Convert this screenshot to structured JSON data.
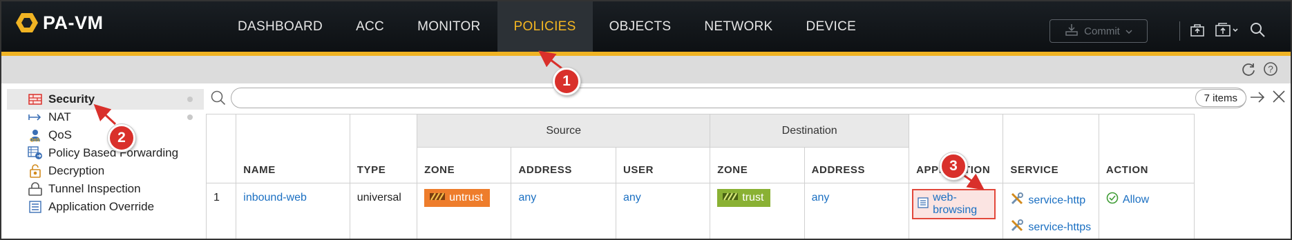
{
  "app": {
    "title": "PA-VM"
  },
  "nav": {
    "items": [
      {
        "label": "DASHBOARD"
      },
      {
        "label": "ACC"
      },
      {
        "label": "MONITOR"
      },
      {
        "label": "POLICIES"
      },
      {
        "label": "OBJECTS"
      },
      {
        "label": "NETWORK"
      },
      {
        "label": "DEVICE"
      }
    ],
    "active": "POLICIES",
    "active_color": "#f5b721",
    "commit_label": "Commit"
  },
  "sidebar": {
    "items": [
      {
        "label": "Security",
        "icon": "security-rule-icon",
        "selected": true
      },
      {
        "label": "NAT",
        "icon": "nat-arrow-icon"
      },
      {
        "label": "QoS",
        "icon": "qos-icon"
      },
      {
        "label": "Policy Based Forwarding",
        "icon": "pbf-icon"
      },
      {
        "label": "Decryption",
        "icon": "decryption-lock-icon"
      },
      {
        "label": "Tunnel Inspection",
        "icon": "tunnel-icon"
      },
      {
        "label": "Application Override",
        "icon": "app-override-icon"
      }
    ]
  },
  "search": {
    "placeholder": "",
    "items_count": "7 items"
  },
  "table": {
    "groups": {
      "source": "Source",
      "destination": "Destination"
    },
    "headers": {
      "name": "NAME",
      "type": "TYPE",
      "src_zone": "ZONE",
      "src_address": "ADDRESS",
      "src_user": "USER",
      "dst_zone": "ZONE",
      "dst_address": "ADDRESS",
      "application": "APPLICATION",
      "service": "SERVICE",
      "action": "ACTION"
    },
    "rows": [
      {
        "num": "1",
        "name": "inbound-web",
        "type": "universal",
        "src_zone": "untrust",
        "src_address": "any",
        "src_user": "any",
        "dst_zone": "trust",
        "dst_address": "any",
        "application": "web-browsing",
        "services": [
          "service-http",
          "service-https"
        ],
        "action": "Allow"
      }
    ]
  },
  "callouts": [
    "1",
    "2",
    "3"
  ],
  "colors": {
    "accent_gold": "#f0b323",
    "untrust_zone": "#ee7d2c",
    "trust_zone": "#8ab134",
    "callout_red": "#d9302b",
    "link_blue": "#1a6fc2"
  }
}
